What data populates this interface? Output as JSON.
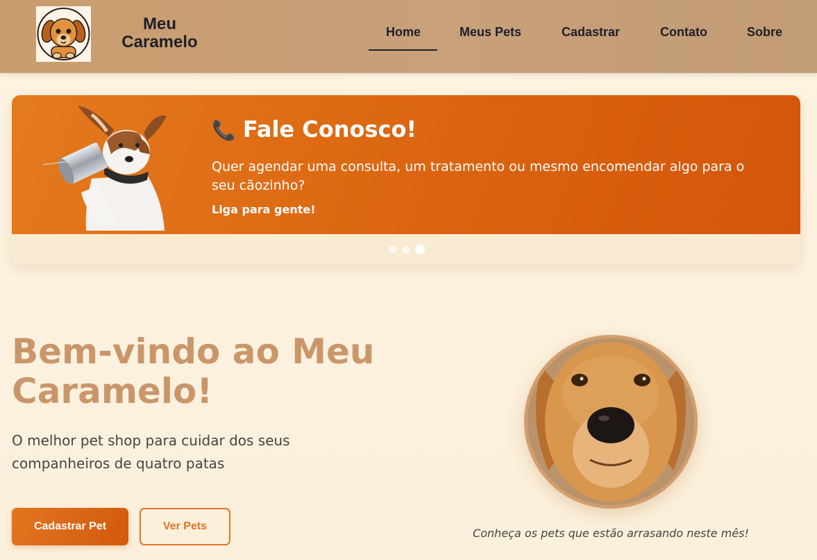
{
  "brand": {
    "name": "Meu Caramelo",
    "logo_icon": "puppy-logo-icon"
  },
  "nav": {
    "items": [
      {
        "label": "Home",
        "active": true
      },
      {
        "label": "Meus Pets"
      },
      {
        "label": "Cadastrar"
      },
      {
        "label": "Contato"
      },
      {
        "label": "Sobre"
      }
    ]
  },
  "carousel": {
    "slide": {
      "icon": "phone-icon",
      "title": "Fale Conosco!",
      "text": "Quer agendar uma consulta, um tratamento ou mesmo encomendar algo para o seu cãozinho?",
      "cta": "Liga para gente!"
    },
    "slides_count": 3,
    "active_slide": 3
  },
  "hero": {
    "title": "Bem-vindo ao Meu Caramelo!",
    "subtitle": "O melhor pet shop para cuidar dos seus companheiros de quatro patas",
    "primary_button": "Cadastrar Pet",
    "secondary_button": "Ver Pets",
    "caption": "Conheça os pets que estão arrasando neste mês!"
  },
  "colors": {
    "header": "#c8a07a",
    "accent": "#e27520",
    "hero_title": "#c9966a",
    "background": "#fdf3e1"
  }
}
